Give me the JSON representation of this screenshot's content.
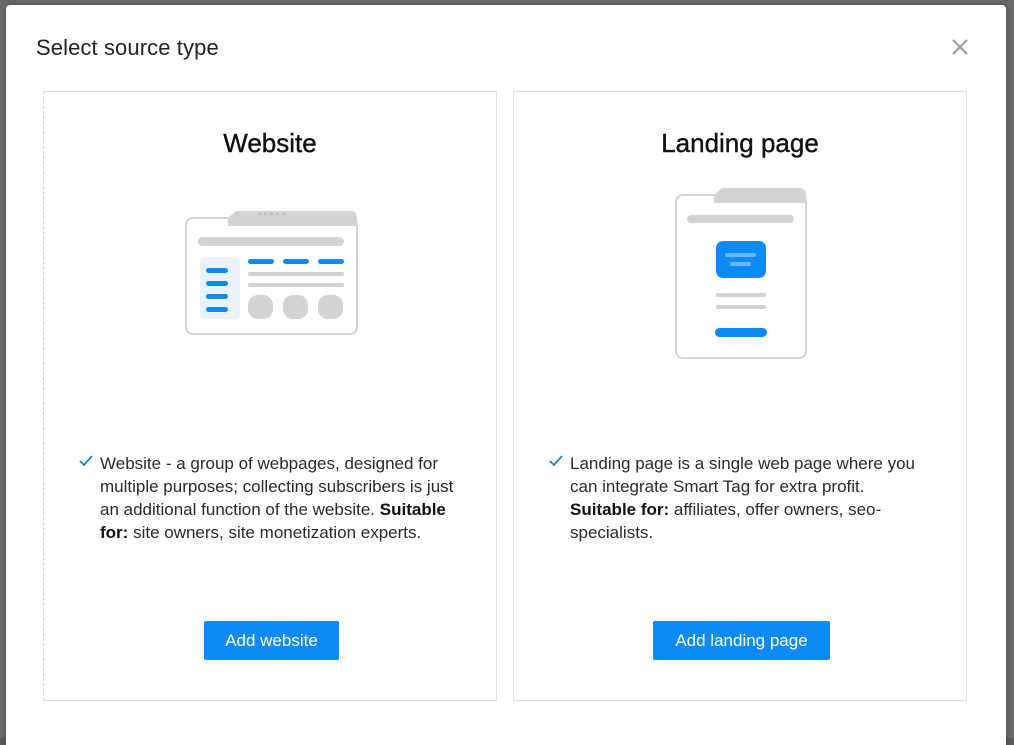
{
  "modal": {
    "title": "Select source type",
    "close_icon": "close-icon"
  },
  "cards": [
    {
      "title": "Website",
      "illustration": "website-illustration-icon",
      "description": "Website - a group of webpages, designed for multiple purposes; collecting subscribers is just an additional function of the website.",
      "suitable_label": "Suitable for:",
      "suitable_text": "site owners, site monetization experts.",
      "button_label": "Add website"
    },
    {
      "title": "Landing page",
      "illustration": "landing-page-illustration-icon",
      "description": "Landing page is a single web page where you can integrate Smart Tag for extra profit.",
      "suitable_label": "Suitable for:",
      "suitable_text": "affiliates, offer owners, seo-specialists.",
      "button_label": "Add landing page"
    }
  ],
  "colors": {
    "accent": "#0d8af5",
    "illustration_gray": "#d3d3d3",
    "check": "#1a7fd4"
  }
}
